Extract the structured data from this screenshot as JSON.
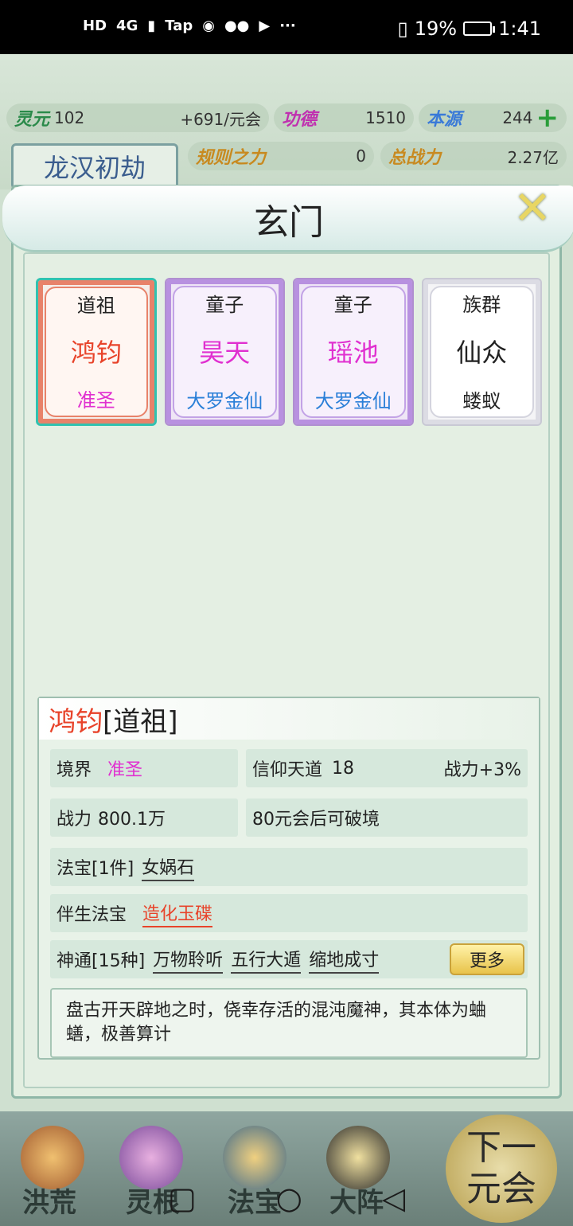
{
  "status_bar": {
    "left_icons": [
      "hd-icon",
      "4g-signal-icon",
      "alert-icon",
      "tap-icon",
      "bulb-icon",
      "wechat-icon",
      "play-icon"
    ],
    "hd": "HD",
    "net": "4G",
    "tap": "Tap",
    "more": "···",
    "battery_pct": "19%",
    "time": "1:41"
  },
  "hud": {
    "lingyuan_label": "灵元",
    "lingyuan_value": "102",
    "lingyuan_rate": "+691/元会",
    "gongde_label": "功德",
    "gongde_value": "1510",
    "benyuan_label": "本源",
    "benyuan_value": "244",
    "guize_label": "规则之力",
    "guize_value": "0",
    "zhanli_label": "总战力",
    "zhanli_value": "2.27亿",
    "era_title": "龙汉初劫"
  },
  "modal": {
    "title": "玄门",
    "close": "✕",
    "cards": [
      {
        "role": "道祖",
        "name": "鸿钧",
        "rank": "准圣",
        "name_color": "#e8432a",
        "rank_color": "#e030d0"
      },
      {
        "role": "童子",
        "name": "昊天",
        "rank": "大罗金仙",
        "name_color": "#e030d0",
        "rank_color": "#2a7fd8"
      },
      {
        "role": "童子",
        "name": "瑶池",
        "rank": "大罗金仙",
        "name_color": "#e030d0",
        "rank_color": "#2a7fd8"
      },
      {
        "role": "族群",
        "name": "仙众",
        "rank": "蝼蚁",
        "name_color": "#222222",
        "rank_color": "#222222"
      }
    ],
    "detail": {
      "name": "鸿钧",
      "role": "[道祖]",
      "realm_label": "境界",
      "realm_value": "准圣",
      "faith_label": "信仰天道",
      "faith_value": "18",
      "faith_bonus": "战力+3%",
      "power_label": "战力",
      "power_value": "800.1万",
      "breakthrough": "80元会后可破境",
      "treasure_label": "法宝[1件]",
      "treasure_value": "女娲石",
      "companion_label": "伴生法宝",
      "companion_value": "造化玉碟",
      "skills_label": "神通[15种]",
      "skills": [
        "万物聆听",
        "五行大遁",
        "缩地成寸"
      ],
      "more_button": "更多",
      "description": "盘古开天辟地之时，侥幸存活的混沌魔神，其本体为蛐蟮，极善算计"
    }
  },
  "bottom_nav": {
    "items": [
      "洪荒",
      "灵根",
      "法宝",
      "大阵"
    ],
    "next_top": "下一",
    "next_bottom": "元会"
  }
}
